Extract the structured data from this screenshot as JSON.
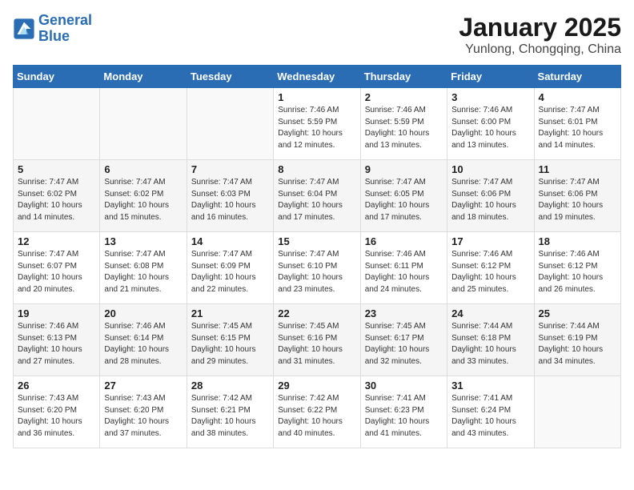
{
  "header": {
    "logo_line1": "General",
    "logo_line2": "Blue",
    "month_title": "January 2025",
    "location": "Yunlong, Chongqing, China"
  },
  "weekdays": [
    "Sunday",
    "Monday",
    "Tuesday",
    "Wednesday",
    "Thursday",
    "Friday",
    "Saturday"
  ],
  "weeks": [
    [
      {
        "day": "",
        "info": ""
      },
      {
        "day": "",
        "info": ""
      },
      {
        "day": "",
        "info": ""
      },
      {
        "day": "1",
        "info": "Sunrise: 7:46 AM\nSunset: 5:59 PM\nDaylight: 10 hours\nand 12 minutes."
      },
      {
        "day": "2",
        "info": "Sunrise: 7:46 AM\nSunset: 5:59 PM\nDaylight: 10 hours\nand 13 minutes."
      },
      {
        "day": "3",
        "info": "Sunrise: 7:46 AM\nSunset: 6:00 PM\nDaylight: 10 hours\nand 13 minutes."
      },
      {
        "day": "4",
        "info": "Sunrise: 7:47 AM\nSunset: 6:01 PM\nDaylight: 10 hours\nand 14 minutes."
      }
    ],
    [
      {
        "day": "5",
        "info": "Sunrise: 7:47 AM\nSunset: 6:02 PM\nDaylight: 10 hours\nand 14 minutes."
      },
      {
        "day": "6",
        "info": "Sunrise: 7:47 AM\nSunset: 6:02 PM\nDaylight: 10 hours\nand 15 minutes."
      },
      {
        "day": "7",
        "info": "Sunrise: 7:47 AM\nSunset: 6:03 PM\nDaylight: 10 hours\nand 16 minutes."
      },
      {
        "day": "8",
        "info": "Sunrise: 7:47 AM\nSunset: 6:04 PM\nDaylight: 10 hours\nand 17 minutes."
      },
      {
        "day": "9",
        "info": "Sunrise: 7:47 AM\nSunset: 6:05 PM\nDaylight: 10 hours\nand 17 minutes."
      },
      {
        "day": "10",
        "info": "Sunrise: 7:47 AM\nSunset: 6:06 PM\nDaylight: 10 hours\nand 18 minutes."
      },
      {
        "day": "11",
        "info": "Sunrise: 7:47 AM\nSunset: 6:06 PM\nDaylight: 10 hours\nand 19 minutes."
      }
    ],
    [
      {
        "day": "12",
        "info": "Sunrise: 7:47 AM\nSunset: 6:07 PM\nDaylight: 10 hours\nand 20 minutes."
      },
      {
        "day": "13",
        "info": "Sunrise: 7:47 AM\nSunset: 6:08 PM\nDaylight: 10 hours\nand 21 minutes."
      },
      {
        "day": "14",
        "info": "Sunrise: 7:47 AM\nSunset: 6:09 PM\nDaylight: 10 hours\nand 22 minutes."
      },
      {
        "day": "15",
        "info": "Sunrise: 7:47 AM\nSunset: 6:10 PM\nDaylight: 10 hours\nand 23 minutes."
      },
      {
        "day": "16",
        "info": "Sunrise: 7:46 AM\nSunset: 6:11 PM\nDaylight: 10 hours\nand 24 minutes."
      },
      {
        "day": "17",
        "info": "Sunrise: 7:46 AM\nSunset: 6:12 PM\nDaylight: 10 hours\nand 25 minutes."
      },
      {
        "day": "18",
        "info": "Sunrise: 7:46 AM\nSunset: 6:12 PM\nDaylight: 10 hours\nand 26 minutes."
      }
    ],
    [
      {
        "day": "19",
        "info": "Sunrise: 7:46 AM\nSunset: 6:13 PM\nDaylight: 10 hours\nand 27 minutes."
      },
      {
        "day": "20",
        "info": "Sunrise: 7:46 AM\nSunset: 6:14 PM\nDaylight: 10 hours\nand 28 minutes."
      },
      {
        "day": "21",
        "info": "Sunrise: 7:45 AM\nSunset: 6:15 PM\nDaylight: 10 hours\nand 29 minutes."
      },
      {
        "day": "22",
        "info": "Sunrise: 7:45 AM\nSunset: 6:16 PM\nDaylight: 10 hours\nand 31 minutes."
      },
      {
        "day": "23",
        "info": "Sunrise: 7:45 AM\nSunset: 6:17 PM\nDaylight: 10 hours\nand 32 minutes."
      },
      {
        "day": "24",
        "info": "Sunrise: 7:44 AM\nSunset: 6:18 PM\nDaylight: 10 hours\nand 33 minutes."
      },
      {
        "day": "25",
        "info": "Sunrise: 7:44 AM\nSunset: 6:19 PM\nDaylight: 10 hours\nand 34 minutes."
      }
    ],
    [
      {
        "day": "26",
        "info": "Sunrise: 7:43 AM\nSunset: 6:20 PM\nDaylight: 10 hours\nand 36 minutes."
      },
      {
        "day": "27",
        "info": "Sunrise: 7:43 AM\nSunset: 6:20 PM\nDaylight: 10 hours\nand 37 minutes."
      },
      {
        "day": "28",
        "info": "Sunrise: 7:42 AM\nSunset: 6:21 PM\nDaylight: 10 hours\nand 38 minutes."
      },
      {
        "day": "29",
        "info": "Sunrise: 7:42 AM\nSunset: 6:22 PM\nDaylight: 10 hours\nand 40 minutes."
      },
      {
        "day": "30",
        "info": "Sunrise: 7:41 AM\nSunset: 6:23 PM\nDaylight: 10 hours\nand 41 minutes."
      },
      {
        "day": "31",
        "info": "Sunrise: 7:41 AM\nSunset: 6:24 PM\nDaylight: 10 hours\nand 43 minutes."
      },
      {
        "day": "",
        "info": ""
      }
    ]
  ]
}
